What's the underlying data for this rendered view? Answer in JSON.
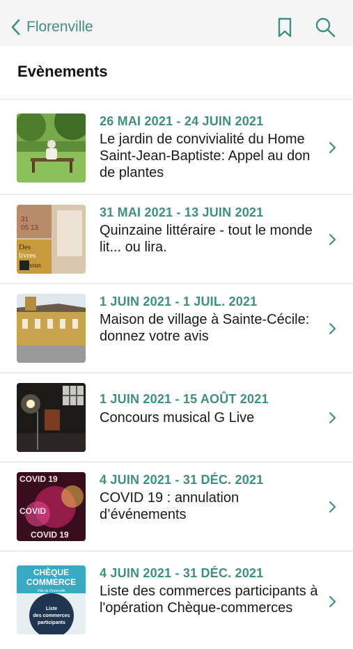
{
  "nav": {
    "back_label": "Florenville",
    "accent": "#3f8f80"
  },
  "section": {
    "title": "Evènements"
  },
  "events": [
    {
      "date": "26 MAI 2021 - 24 JUIN 2021",
      "title": "Le jardin de convivialité du Home Saint-Jean-Baptiste: Appel au don de plantes",
      "thumb": "garden-photo"
    },
    {
      "date": "31 MAI 2021 - 13 JUIN 2021",
      "title": "Quinzaine littéraire - tout le monde lit... ou lira.",
      "thumb": "books-poster",
      "thumb_text": [
        "Des",
        "livres",
        "nous"
      ]
    },
    {
      "date": "1 JUIN 2021 - 1 JUIL. 2021",
      "title": "Maison de village à Sainte-Cécile: donnez votre avis",
      "thumb": "village-house-photo"
    },
    {
      "date": "1 JUIN 2021 - 15 AOÛT 2021",
      "title": "Concours musical G Live",
      "thumb": "stage-photo"
    },
    {
      "date": "4 JUIN 2021 - 31 DÉC. 2021",
      "title": "COVID 19 : annulation d’événements",
      "thumb": "covid-poster",
      "thumb_text": [
        "COVID 19",
        "COVID",
        "COVID 19"
      ]
    },
    {
      "date": "4 JUIN 2021 - 31 DÉC. 2021",
      "title": "Liste des commerces participants à l'opération Chèque-commerces",
      "thumb": "cheque-commerce-poster",
      "thumb_text": [
        "CHÈQUE",
        "COMMERCE",
        "Ville de Florenville",
        "Liste",
        "des commerces",
        "participants"
      ]
    }
  ]
}
